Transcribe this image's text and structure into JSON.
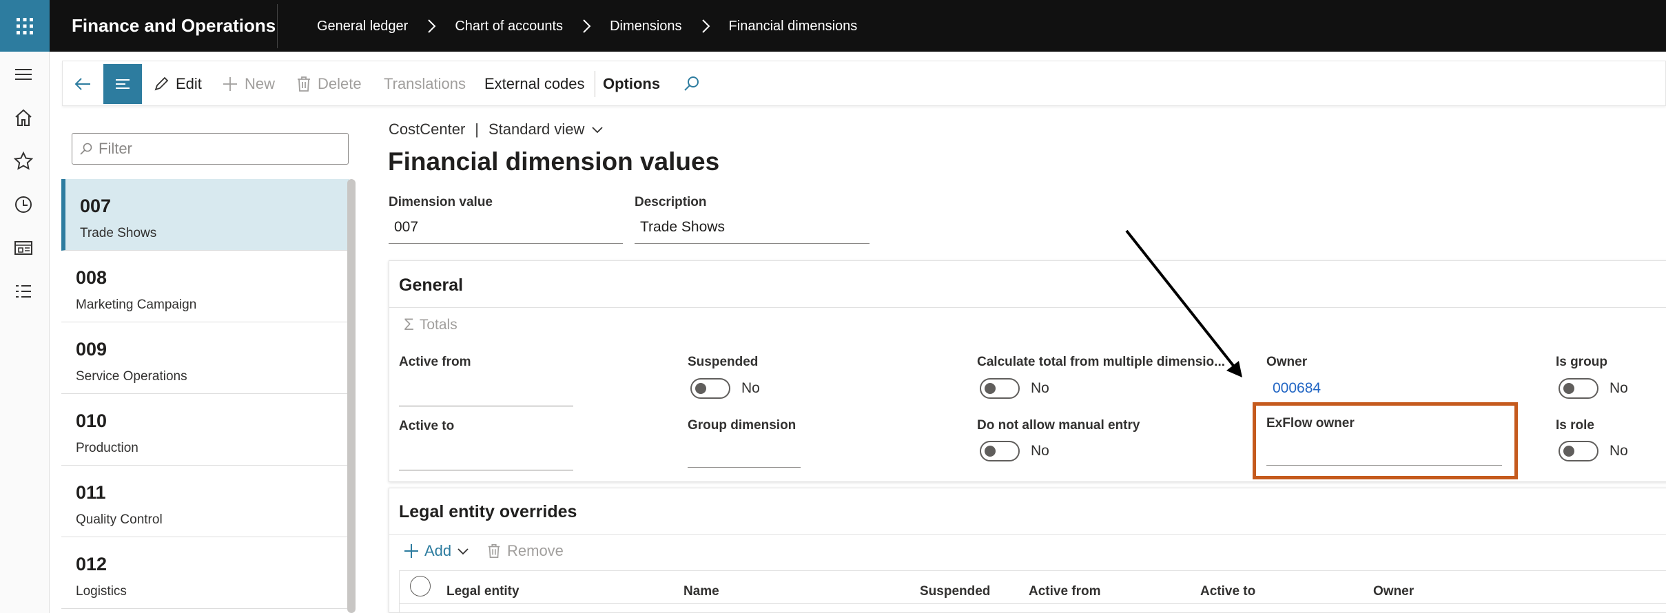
{
  "app": {
    "title": "Finance and Operations"
  },
  "breadcrumb": [
    "General ledger",
    "Chart of accounts",
    "Dimensions",
    "Financial dimensions"
  ],
  "toolbar": {
    "edit": "Edit",
    "new": "New",
    "delete": "Delete",
    "translations": "Translations",
    "external_codes": "External codes",
    "options": "Options"
  },
  "list": {
    "filter_placeholder": "Filter",
    "items": [
      {
        "code": "007",
        "desc": "Trade Shows"
      },
      {
        "code": "008",
        "desc": "Marketing Campaign"
      },
      {
        "code": "009",
        "desc": "Service Operations"
      },
      {
        "code": "010",
        "desc": "Production"
      },
      {
        "code": "011",
        "desc": "Quality Control"
      },
      {
        "code": "012",
        "desc": "Logistics"
      }
    ]
  },
  "header": {
    "entity": "CostCenter",
    "separator": "|",
    "view": "Standard view",
    "title": "Financial dimension values",
    "dimension_value_label": "Dimension value",
    "dimension_value": "007",
    "description_label": "Description",
    "description": "Trade Shows"
  },
  "general": {
    "title": "General",
    "totals": "Totals",
    "active_from": "Active from",
    "active_to": "Active to",
    "suspended": "Suspended",
    "suspended_value": "No",
    "group_dimension": "Group dimension",
    "calc_total": "Calculate total from multiple dimensio...",
    "calc_total_value": "No",
    "no_manual": "Do not allow manual entry",
    "no_manual_value": "No",
    "owner": "Owner",
    "owner_value": "000684",
    "exflow_owner": "ExFlow owner",
    "is_group": "Is group",
    "is_group_value": "No",
    "is_role": "Is role",
    "is_role_value": "No"
  },
  "overrides": {
    "title": "Legal entity overrides",
    "add": "Add",
    "remove": "Remove",
    "columns": [
      "Legal entity",
      "Name",
      "Suspended",
      "Active from",
      "Active to",
      "Owner"
    ]
  },
  "colors": {
    "accent": "#2d7c9f",
    "highlight": "#c55a1d",
    "link": "#2266c4",
    "topbar": "#111111"
  }
}
